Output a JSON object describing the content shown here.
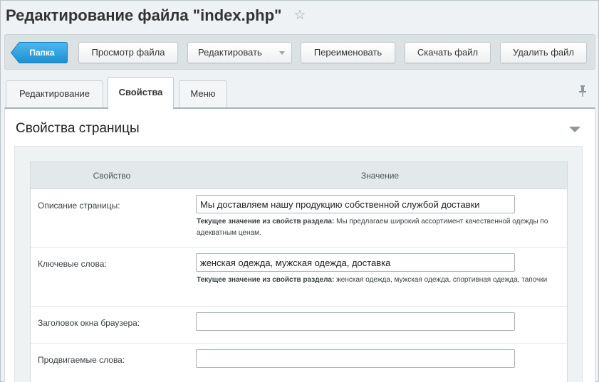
{
  "page": {
    "title": "Редактирование файла \"index.php\""
  },
  "toolbar": {
    "folder_label": "Папка",
    "view_label": "Просмотр файла",
    "edit_label": "Редактировать",
    "rename_label": "Переименовать",
    "download_label": "Скачать файл",
    "delete_label": "Удалить файл"
  },
  "tabs": [
    {
      "label": "Редактирование"
    },
    {
      "label": "Свойства"
    },
    {
      "label": "Меню"
    }
  ],
  "section": {
    "title": "Свойства страницы"
  },
  "table": {
    "headers": {
      "property": "Свойство",
      "value": "Значение"
    },
    "hint_prefix": "Текущее значение из свойств раздела:",
    "rows": [
      {
        "label": "Описание страницы:",
        "value": "Мы доставляем нашу продукцию собственной службой доставки",
        "hint": "Мы предлагаем широкий ассортимент качественной одежды по адекватным ценам."
      },
      {
        "label": "Ключевые слова:",
        "value": "женская одежда, мужская одежда, доставка",
        "hint": "женская одежда, мужская одежда, спортивная одежда, тапочки"
      },
      {
        "label": "Заголовок окна браузера:",
        "value": ""
      },
      {
        "label": "Продвигаемые слова:",
        "value": ""
      }
    ]
  },
  "colors": {
    "folder_button": "#2fa3e0",
    "page_background": "#eef2f4",
    "toolbar_background": "#dce2e4"
  },
  "icons": {
    "favorite": "star-icon",
    "pin": "pin-icon",
    "collapse": "chevron-down-icon",
    "dropdown": "caret-down-icon"
  }
}
